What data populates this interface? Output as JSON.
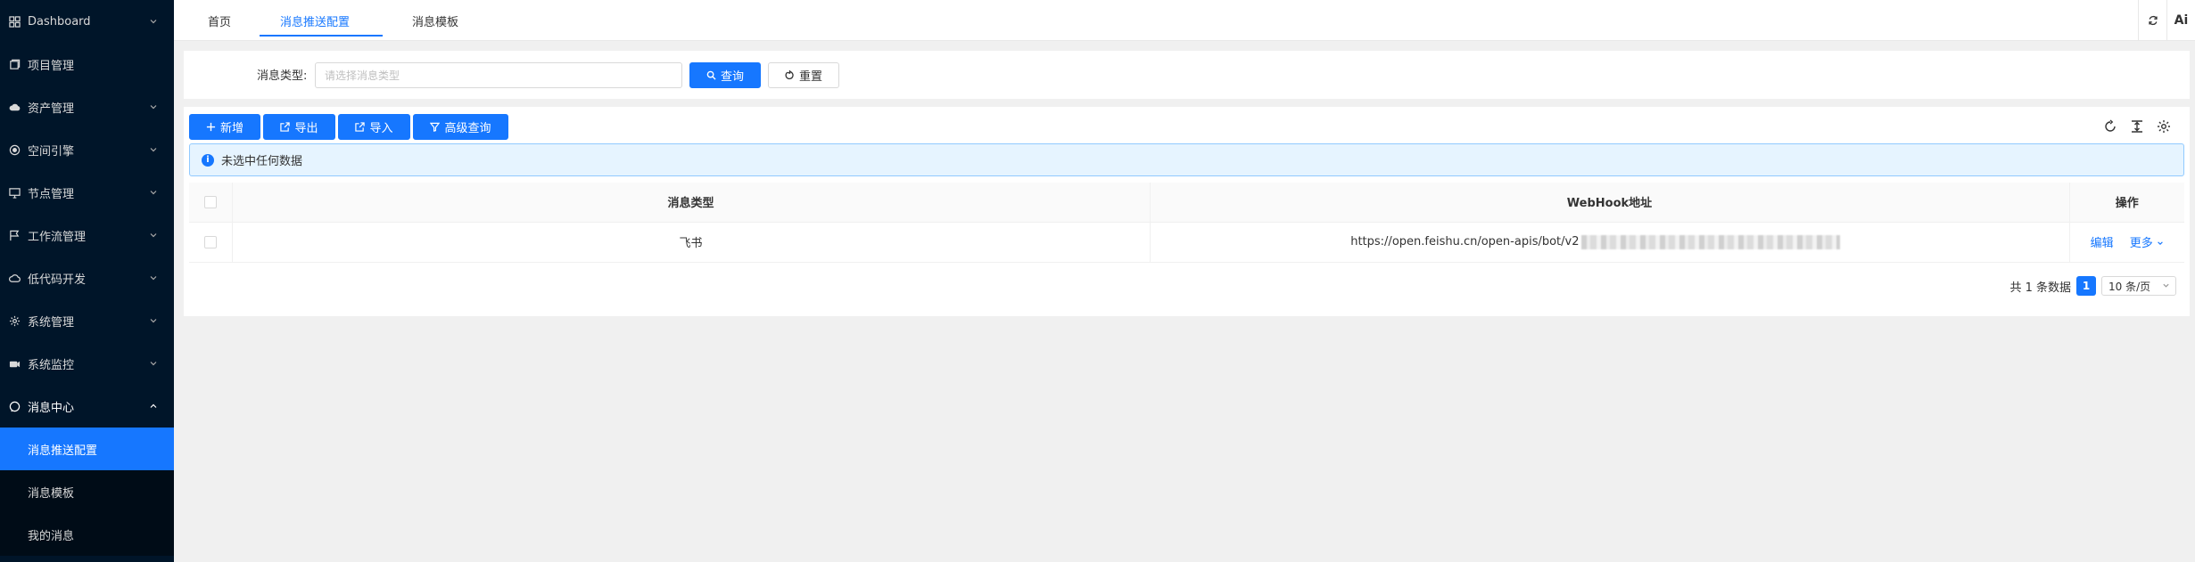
{
  "sidebar": {
    "items": [
      {
        "label": "Dashboard",
        "icon": "dashboard-icon",
        "has_arrow": true
      },
      {
        "label": "项目管理",
        "icon": "project-icon",
        "has_arrow": false
      },
      {
        "label": "资产管理",
        "icon": "cloud-icon",
        "has_arrow": true
      },
      {
        "label": "空间引擎",
        "icon": "space-icon",
        "has_arrow": true
      },
      {
        "label": "节点管理",
        "icon": "monitor-icon",
        "has_arrow": true
      },
      {
        "label": "工作流管理",
        "icon": "flag-icon",
        "has_arrow": true
      },
      {
        "label": "低代码开发",
        "icon": "cloud-outline-icon",
        "has_arrow": true
      },
      {
        "label": "系统管理",
        "icon": "gear-icon",
        "has_arrow": true
      },
      {
        "label": "系统监控",
        "icon": "camera-icon",
        "has_arrow": true
      },
      {
        "label": "消息中心",
        "icon": "message-icon",
        "has_arrow": true
      }
    ],
    "sub_items": [
      {
        "label": "消息推送配置"
      },
      {
        "label": "消息模板"
      },
      {
        "label": "我的消息"
      }
    ]
  },
  "tabs": [
    {
      "label": "首页"
    },
    {
      "label": "消息推送配置"
    },
    {
      "label": "消息模板"
    }
  ],
  "topbar": {
    "ai_label": "Ai"
  },
  "search": {
    "label": "消息类型:",
    "placeholder": "请选择消息类型",
    "query_label": "查询",
    "reset_label": "重置"
  },
  "toolbar": {
    "add_label": "新增",
    "export_label": "导出",
    "import_label": "导入",
    "advanced_label": "高级查询"
  },
  "alert": {
    "text": "未选中任何数据"
  },
  "table": {
    "headers": [
      "消息类型",
      "WebHook地址",
      "操作"
    ],
    "rows": [
      {
        "type": "飞书",
        "webhook": "https://open.feishu.cn/open-apis/bot/v2",
        "edit": "编辑",
        "more": "更多"
      }
    ]
  },
  "pagination": {
    "total_text": "共 1 条数据",
    "current_page": "1",
    "page_size": "10 条/页"
  },
  "colors": {
    "primary": "#1677ff",
    "sidebar": "#001529"
  }
}
